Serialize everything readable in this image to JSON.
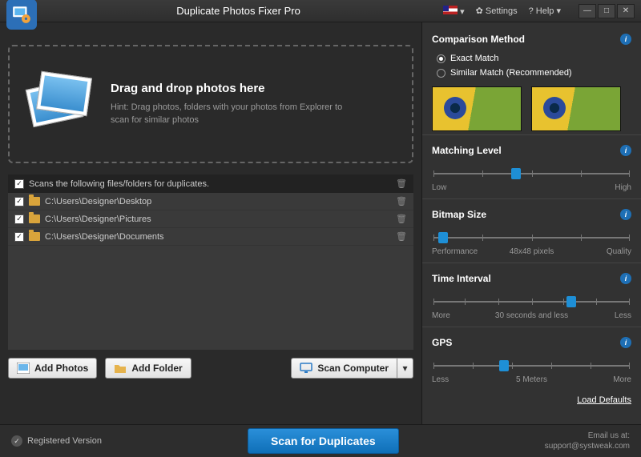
{
  "app": {
    "title": "Duplicate Photos Fixer Pro"
  },
  "titlebar": {
    "settings": "Settings",
    "help": "? Help"
  },
  "dropzone": {
    "heading": "Drag and drop photos here",
    "hint": "Hint: Drag photos, folders with your photos from Explorer to scan for similar photos"
  },
  "list": {
    "header": "Scans the following files/folders for duplicates.",
    "items": [
      {
        "path": "C:\\Users\\Designer\\Desktop"
      },
      {
        "path": "C:\\Users\\Designer\\Pictures"
      },
      {
        "path": "C:\\Users\\Designer\\Documents"
      }
    ]
  },
  "actions": {
    "add_photos": "Add Photos",
    "add_folder": "Add Folder",
    "scan_computer": "Scan Computer"
  },
  "comparison": {
    "title": "Comparison Method",
    "exact": "Exact Match",
    "similar": "Similar Match (Recommended)"
  },
  "sliders": {
    "matching": {
      "title": "Matching Level",
      "low": "Low",
      "high": "High"
    },
    "bitmap": {
      "title": "Bitmap Size",
      "low": "Performance",
      "mid": "48x48 pixels",
      "high": "Quality"
    },
    "time": {
      "title": "Time Interval",
      "low": "More",
      "mid": "30 seconds and less",
      "high": "Less"
    },
    "gps": {
      "title": "GPS",
      "low": "Less",
      "mid": "5 Meters",
      "high": "More"
    }
  },
  "load_defaults": "Load Defaults",
  "footer": {
    "registered": "Registered Version",
    "scan": "Scan for Duplicates",
    "email_label": "Email us at:",
    "email": "support@systweak.com"
  }
}
